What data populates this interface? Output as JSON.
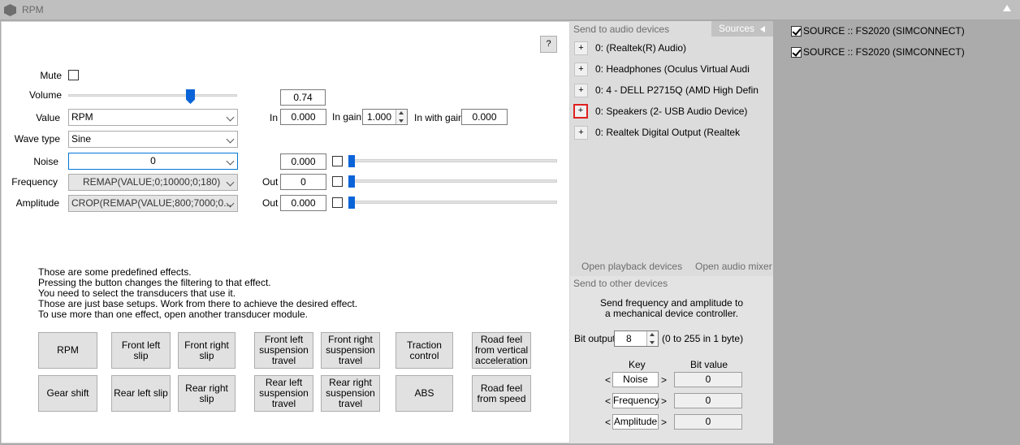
{
  "window": {
    "title": "RPM"
  },
  "main": {
    "help_label": "?",
    "mute": {
      "label": "Mute",
      "checked": false
    },
    "volume": {
      "label": "Volume",
      "value": "0.74",
      "slider_fraction": 0.74
    },
    "value": {
      "label": "Value",
      "selected": "RPM",
      "in_label": "In",
      "in_value": "0.000",
      "in_gain_label": "In gain",
      "in_gain_value": "1.000",
      "in_with_gain_label": "In with gain",
      "in_with_gain_value": "0.000"
    },
    "wave_type": {
      "label": "Wave type",
      "selected": "Sine"
    },
    "noise": {
      "label": "Noise",
      "selected": "0",
      "value": "0.000",
      "checked": false
    },
    "frequency": {
      "label": "Frequency",
      "selected": "REMAP(VALUE;0;10000;0;180)",
      "out_label": "Out",
      "out_value": "0",
      "checked": false
    },
    "amplitude": {
      "label": "Amplitude",
      "selected": "CROP(REMAP(VALUE;800;7000;0...",
      "out_label": "Out",
      "out_value": "0.000",
      "checked": false
    },
    "info_lines": [
      "Those are some predefined effects.",
      "Pressing the button changes the filtering to that effect.",
      "You need to select the transducers that use it.",
      "Those are just base setups. Work from there to achieve the desired effect.",
      "To use more than one effect, open another transducer module."
    ],
    "effects": {
      "rpm": "RPM",
      "front_left_slip": "Front left slip",
      "front_right_slip": "Front right slip",
      "front_left_travel": "Front left suspension travel",
      "front_right_travel": "Front right suspension travel",
      "traction_control": "Traction control",
      "road_feel_vertical": "Road feel from vertical acceleration",
      "gear_shift": "Gear shift",
      "rear_left_slip": "Rear left slip",
      "rear_right_slip": "Rear right slip",
      "rear_left_travel": "Rear left suspension travel",
      "rear_right_travel": "Rear right suspension travel",
      "abs": "ABS",
      "road_feel_speed": "Road feel from speed"
    }
  },
  "audio": {
    "header": "Send to audio devices",
    "sources_tab": "Sources",
    "devices": [
      {
        "plus": "+",
        "label": "0:  (Realtek(R) Audio)"
      },
      {
        "plus": "+",
        "label": "0: Headphones (Oculus Virtual Audi"
      },
      {
        "plus": "+",
        "label": "0: 4 - DELL P2715Q (AMD High Defin"
      },
      {
        "plus": "+",
        "label": "0: Speakers (2- USB Audio Device)"
      },
      {
        "plus": "+",
        "label": "0: Realtek Digital Output (Realtek"
      }
    ],
    "open_playback": "Open playback devices",
    "open_mixer": "Open audio mixer"
  },
  "other": {
    "header": "Send to other devices",
    "description_line1": "Send frequency and amplitude to",
    "description_line2": "a mechanical device controller.",
    "bit_output_label": "Bit output",
    "bit_output_value": "8",
    "bit_output_hint": "(0 to 255 in 1 byte)",
    "key_header": "Key",
    "bit_value_header": "Bit value",
    "rows": [
      {
        "key": "Noise",
        "bit_value": "0"
      },
      {
        "key": "Frequency",
        "bit_value": "0"
      },
      {
        "key": "Amplitude",
        "bit_value": "0"
      }
    ],
    "left_arrow": "<",
    "right_arrow": ">"
  },
  "sources": [
    {
      "label": "SOURCE :: FS2020 (SIMCONNECT)",
      "checked": true
    },
    {
      "label": "SOURCE :: FS2020 (SIMCONNECT)",
      "checked": true
    }
  ],
  "colors": {
    "slider_thumb": "#0a64d8",
    "highlight_border": "#e02020"
  }
}
